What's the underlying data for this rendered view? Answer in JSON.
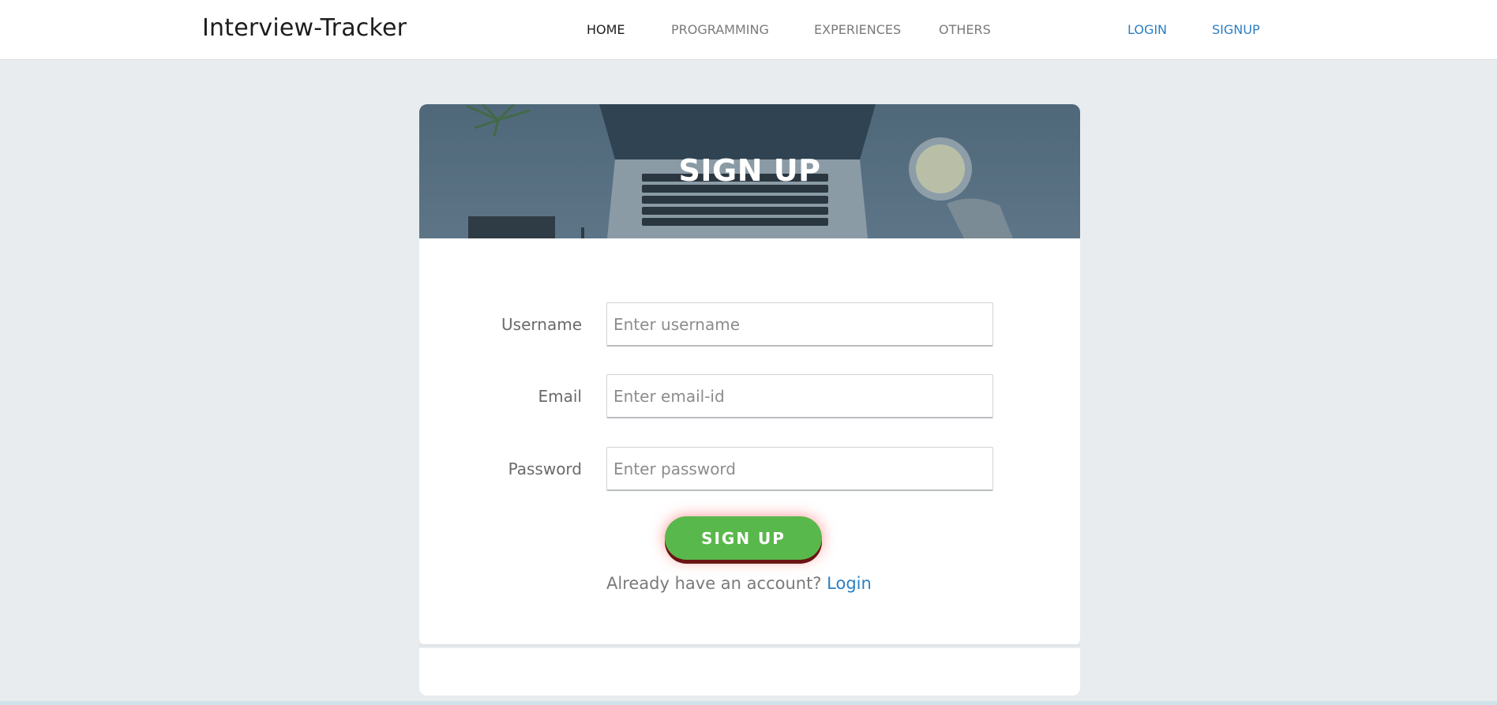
{
  "navbar": {
    "brand": "Interview-Tracker",
    "links": [
      {
        "label": "HOME",
        "active": true
      },
      {
        "label": "PROGRAMMING",
        "active": false
      },
      {
        "label": "EXPERIENCES",
        "active": false
      },
      {
        "label": "OTHERS",
        "active": false
      }
    ],
    "auth": {
      "login": "LOGIN",
      "signup": "SIGNUP"
    }
  },
  "banner": {
    "title": "SIGN UP"
  },
  "form": {
    "username": {
      "label": "Username",
      "placeholder": "Enter username",
      "value": ""
    },
    "email": {
      "label": "Email",
      "placeholder": "Enter email-id",
      "value": ""
    },
    "password": {
      "label": "Password",
      "placeholder": "Enter password",
      "value": ""
    },
    "submit_label": "SIGN UP",
    "account_prompt": "Already have an account?",
    "login_link": "Login"
  },
  "colors": {
    "accent": "#2b7fc4",
    "button": "#59b84b",
    "background": "#e8ecee"
  }
}
